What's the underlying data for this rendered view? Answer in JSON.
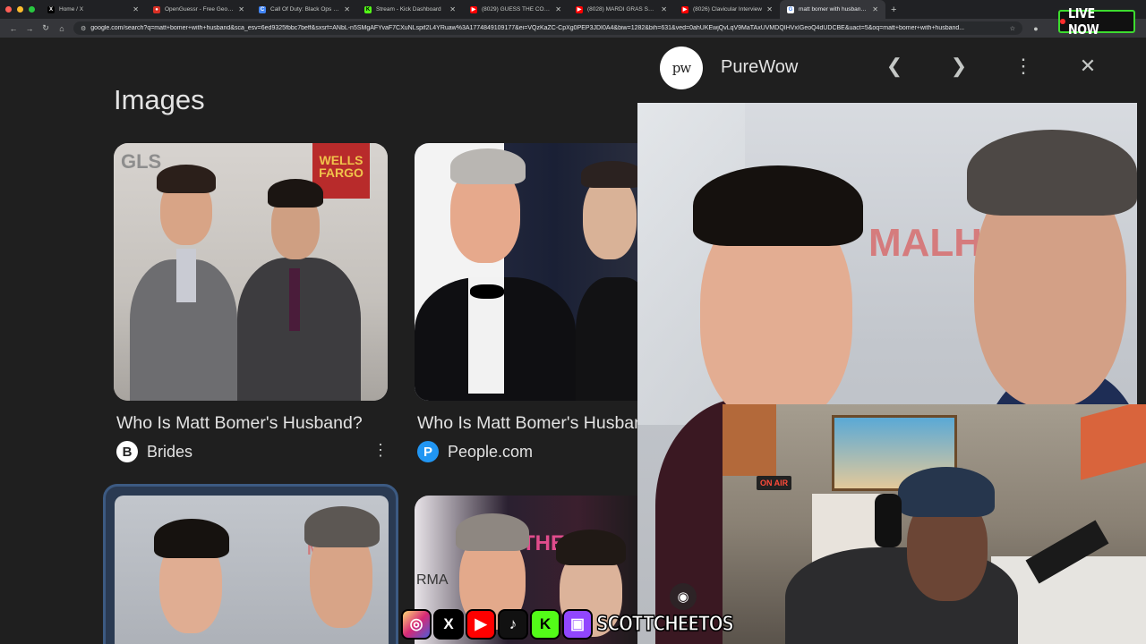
{
  "browser": {
    "tabs": [
      {
        "title": "Home / X",
        "icon": "x-icon",
        "color": "#000000",
        "glyph": "X"
      },
      {
        "title": "OpenGuessr - Free GeoGuessr Alternative",
        "icon": "openguessr-icon",
        "color": "#d93025",
        "glyph": "●"
      },
      {
        "title": "Call Of Duty: Black Ops 7 Season",
        "icon": "cod-icon",
        "color": "#4285f4",
        "glyph": "C"
      },
      {
        "title": "Stream - Kick Dashboard",
        "icon": "kick-icon",
        "color": "#53fc18",
        "glyph": "K"
      },
      {
        "title": "(8029) GUESS THE COMEDIAN",
        "icon": "youtube-icon",
        "color": "#ff0000",
        "glyph": "▶"
      },
      {
        "title": "(8028) MARDI GRAS SMOKE",
        "icon": "youtube-icon",
        "color": "#ff0000",
        "glyph": "▶"
      },
      {
        "title": "(8026) Clavicular Interview",
        "icon": "youtube-icon",
        "color": "#ff0000",
        "glyph": "▶"
      },
      {
        "title": "matt bomer with husband - Google Search",
        "icon": "google-icon",
        "color": "#ffffff",
        "glyph": "G"
      }
    ],
    "url": "google.com/search?q=matt+bomer+with+husband&sca_esv=6ed9325fbbc7beff&sxsrf=ANbL-n5SMgAFYvaF7CXuNLspif2L4YRuaw%3A1774849109177&ei=VQzKaZC-CpXg0PEP3JDI0A4&biw=1282&bih=631&ved=0ahUKEwjQvLqV9MaTAxUVMDQIHVxIGeoQ4dUDCBE&uact=5&oq=matt+bomer+with+husband..."
  },
  "live_badge": "LIVE NOW",
  "results": {
    "section_title": "Images",
    "cards": [
      {
        "title": "Who Is Matt Bomer's Husband?",
        "source": "Brides",
        "source_icon": "brides-icon",
        "badge": "B",
        "badge_color": "#ffffff"
      },
      {
        "title": "Who Is Matt Bomer's Husband?",
        "source": "People.com",
        "source_icon": "people-icon",
        "badge": "P",
        "badge_color": "#2196f3"
      }
    ]
  },
  "preview": {
    "site_logo": "pw",
    "site_name": "PureWow",
    "photo_text": "MALH"
  },
  "webcam": {
    "on_air": "ON AIR"
  },
  "social": {
    "icons": [
      "instagram-icon",
      "x-icon",
      "youtube-icon",
      "tiktok-icon",
      "kick-icon",
      "twitch-icon"
    ],
    "handle": "SCOTTCHEETOS"
  },
  "colors": {
    "background": "#1f1f1f",
    "live_border": "#3ddc2f",
    "kick_green": "#53fc18"
  }
}
